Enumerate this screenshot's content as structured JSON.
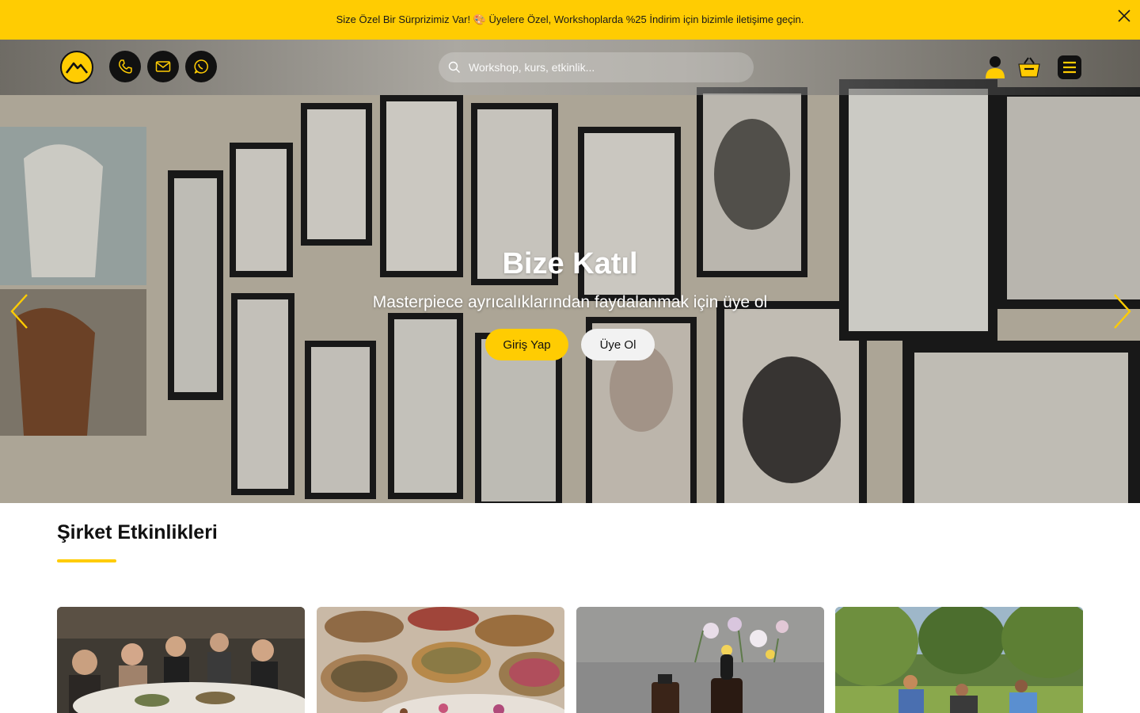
{
  "announcement": {
    "text": "Size Özel Bir Sürprizimiz Var! 🎨 Üyelere Özel, Workshoplarda %25 İndirim için bizimle iletişime geçin.",
    "close_icon": "close-icon"
  },
  "header": {
    "logo_icon": "mountain-logo-icon",
    "contact_icons": [
      "phone-icon",
      "mail-icon",
      "whatsapp-icon"
    ],
    "search": {
      "placeholder": "Workshop, kurs, etkinlik...",
      "icon": "search-icon"
    },
    "right_icons": [
      "user-icon",
      "basket-icon",
      "menu-icon"
    ]
  },
  "hero": {
    "title": "Bize Katıl",
    "subtitle": "Masterpiece ayrıcalıklarından faydalanmak için üye ol",
    "login_label": "Giriş Yap",
    "signup_label": "Üye Ol",
    "prev_icon": "chevron-left-icon",
    "next_icon": "chevron-right-icon"
  },
  "section": {
    "title": "Şirket Etkinlikleri",
    "cards": [
      {
        "image": "workshop-group-photo"
      },
      {
        "image": "dried-flowers-bowls-photo"
      },
      {
        "image": "flowers-dropper-bottles-photo"
      },
      {
        "image": "park-yoga-photo"
      }
    ]
  },
  "colors": {
    "accent": "#ffcc02",
    "dark": "#111111"
  }
}
